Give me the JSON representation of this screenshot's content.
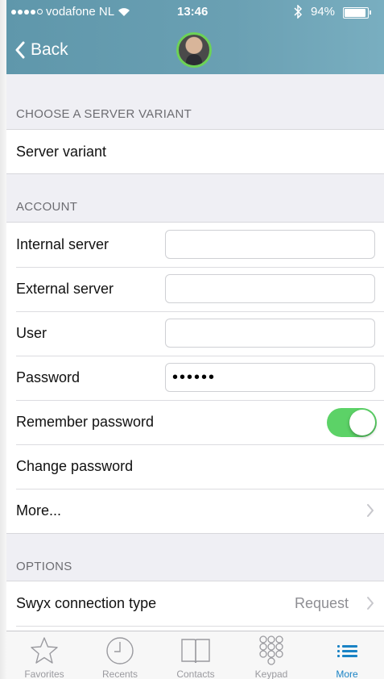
{
  "status_bar": {
    "carrier": "vodafone NL",
    "time": "13:46",
    "battery_pct": "94%"
  },
  "nav": {
    "back_label": "Back"
  },
  "sections": {
    "server_variant": {
      "title": "CHOOSE A SERVER VARIANT",
      "row_label": "Server variant"
    },
    "account": {
      "title": "ACCOUNT",
      "internal_server": {
        "label": "Internal server",
        "value": ""
      },
      "external_server": {
        "label": "External server",
        "value": ""
      },
      "user": {
        "label": "User",
        "value": ""
      },
      "password": {
        "label": "Password",
        "value": "••••••"
      },
      "remember_password": {
        "label": "Remember password",
        "on": true
      },
      "change_password": {
        "label": "Change password"
      },
      "more": {
        "label": "More..."
      }
    },
    "options": {
      "title": "OPTIONS",
      "connection_type": {
        "label": "Swyx connection type",
        "value": "Request"
      }
    }
  },
  "tabbar": {
    "favorites": "Favorites",
    "recents": "Recents",
    "contacts": "Contacts",
    "keypad": "Keypad",
    "more": "More",
    "active": "More"
  },
  "colors": {
    "header": "#6aa0b3",
    "toggle_on": "#5cd267",
    "active_tab": "#1a83c5"
  }
}
